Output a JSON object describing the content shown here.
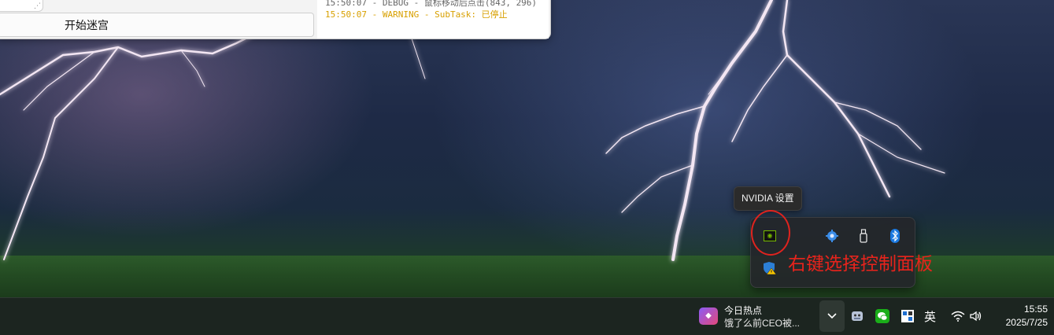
{
  "app_window": {
    "start_button_label": "开始迷宫",
    "log_lines": [
      "15:50:07 - DEBUG - 鼠标移动后点击(843, 296)",
      "15:50:07 - WARNING - SubTask: 已停止"
    ]
  },
  "tooltip": {
    "text": "NVIDIA 设置"
  },
  "tray_overflow": {
    "icons": [
      "nvidia-icon",
      "gear-icon",
      "usb-icon",
      "bluetooth-icon",
      "windows-security-warning-icon"
    ]
  },
  "annotation": {
    "text": "右键选择控制面板",
    "color": "#e8231c"
  },
  "taskbar": {
    "news": {
      "title": "今日热点",
      "subtitle": "饿了么前CEO被..."
    },
    "ime": "英",
    "time": "15:55",
    "date": "2025/7/25"
  },
  "colors": {
    "nvidia_green": "#76b900",
    "warning_log": "#d8a000",
    "annotation_red": "#e0231e"
  }
}
